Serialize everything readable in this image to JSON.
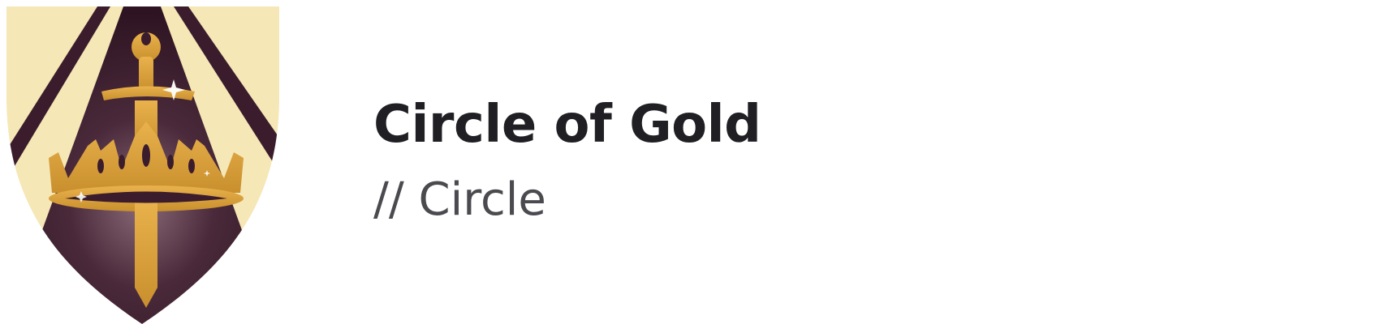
{
  "card": {
    "title": "Circle of Gold",
    "subtitle": "// Circle"
  },
  "emblem": {
    "icon": "circle-of-gold-crest-icon",
    "colors": {
      "cream": "#f5e7b6",
      "plum": "#3a1c2c",
      "gold": "#d9a23e"
    }
  }
}
